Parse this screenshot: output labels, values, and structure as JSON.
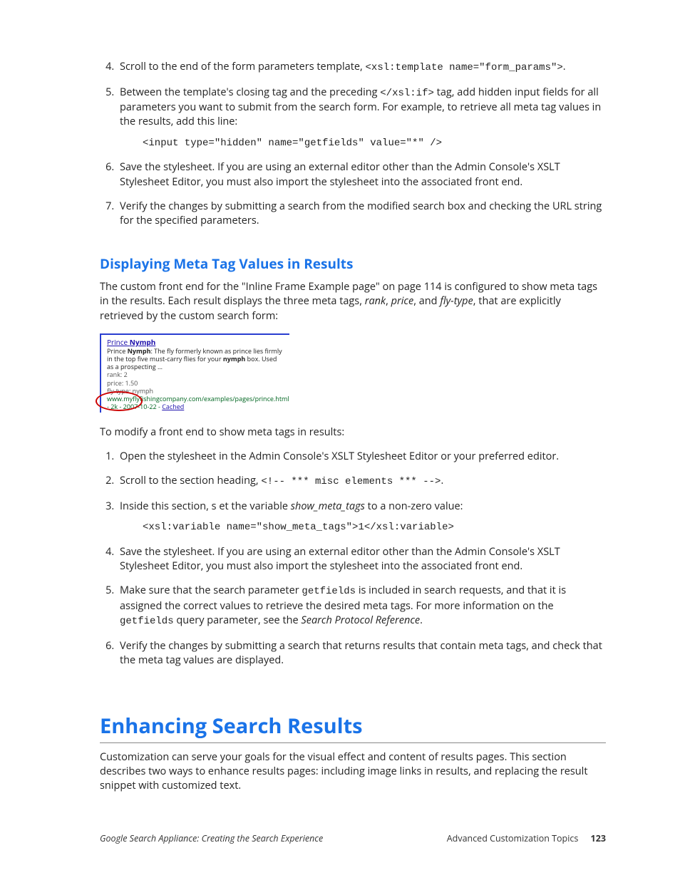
{
  "listA": {
    "start": 4,
    "items": [
      {
        "pre": "Scroll to the end of the form parameters template, ",
        "code1": "<xsl:template name=\"form_params\">",
        "post": "."
      },
      {
        "pre": "Between the template's closing tag and the preceding ",
        "code1": "</xsl:if>",
        "mid": " tag, add hidden input fields for all parameters you want to submit from the search form. For example, to retrieve all meta tag values in the results, add this line:",
        "block": "<input type=\"hidden\" name=\"getfields\" value=\"*\" />"
      },
      {
        "text": "Save the stylesheet. If you are using an external editor other than the Admin Console's XSLT Stylesheet Editor, you must also import the stylesheet into the associated front end."
      },
      {
        "text": "Verify the changes by submitting a search from the modified search box and checking the URL string for the specified parameters."
      }
    ]
  },
  "subhead1": "Displaying Meta Tag Values in Results",
  "para1": {
    "t1": "The custom front end for the \"Inline Frame Example page\" on page 114 is configured to show meta tags in the results. Each result displays the three meta tags, ",
    "v1": "rank",
    "t2": ", ",
    "v2": "price",
    "t3": ", and ",
    "v3": "fly-type",
    "t4": ", that are explicitly retrieved by the custom search form:"
  },
  "figure": {
    "title_pre": "Prince ",
    "title_bold": "Nymph",
    "snip1": "Prince ",
    "snip1b": "Nymph",
    "snip2": ": The fly formerly known as prince lies firmly in the top five must-carry flies for your ",
    "snip2b": "nymph",
    "snip3": " box. Used as a prospecting ...",
    "meta1": "rank: 2",
    "meta2": "price: 1.50",
    "meta3": "fly-type: nymph",
    "url": "www.myflyfishingcompany.com/examples/pages/prince.html - 2k - 2007-10-22 - ",
    "cache": "Cached"
  },
  "para2": "To modify a front end to show meta tags in results:",
  "listB": {
    "start": 1,
    "items": [
      {
        "text": "Open the stylesheet in the Admin Console's XSLT Stylesheet Editor or your preferred editor."
      },
      {
        "pre": "Scroll to the section heading, ",
        "code1": "<!-- *** misc elements *** -->",
        "post": "."
      },
      {
        "pre": "Inside this section, s et the variable ",
        "var": "show_meta_tags",
        "post": " to a non-zero value:",
        "block": "<xsl:variable name=\"show_meta_tags\">1</xsl:variable>"
      },
      {
        "text": "Save the stylesheet. If you are using an external editor other than the Admin Console's XSLT Stylesheet Editor, you must also import the stylesheet into the associated front end."
      },
      {
        "pre": "Make sure that the search parameter ",
        "code1": "getfields",
        "mid": " is included in search requests, and that it is assigned the correct values to retrieve the desired meta tags. For more information on the ",
        "code2": "getfields",
        "post2": " query parameter, see the ",
        "var": "Search Protocol Reference",
        "post3": "."
      },
      {
        "text": "Verify the changes by submitting a search that returns results that contain meta tags, and check that the meta tag values are displayed."
      }
    ]
  },
  "sectionHead": "Enhancing Search Results",
  "para3": "Customization can serve your goals for the visual effect and content of results pages. This section describes two ways to enhance results pages: including image links in results, and replacing the result snippet with customized text.",
  "footer": {
    "left": "Google Search Appliance: Creating the Search Experience",
    "rightLabel": "Advanced Customization Topics",
    "page": "123"
  }
}
